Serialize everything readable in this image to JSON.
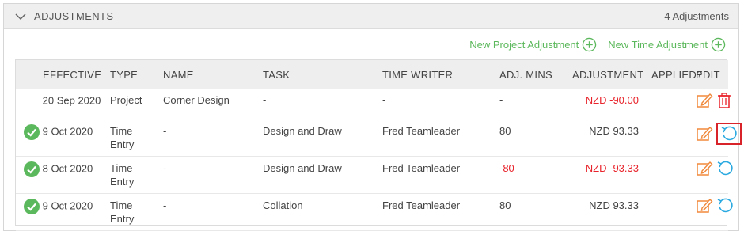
{
  "panel": {
    "title": "ADJUSTMENTS",
    "count_label": "4 Adjustments"
  },
  "actions": {
    "new_project_label": "New Project Adjustment",
    "new_time_label": "New Time Adjustment"
  },
  "table": {
    "headers": [
      "EFFECTIVE",
      "TYPE",
      "NAME",
      "TASK",
      "TIME WRITER",
      "ADJ. MINS",
      "ADJUSTMENT",
      "APPLIED?",
      "EDIT"
    ],
    "rows": [
      {
        "applied": false,
        "effective": "20 Sep 2020",
        "type": "Project",
        "type2": "",
        "name": "Corner Design",
        "task": "-",
        "writer": "-",
        "mins": "-",
        "adjustment": "NZD -90.00",
        "adjustment_negative": true,
        "mins_negative": false,
        "action": "delete"
      },
      {
        "applied": true,
        "effective": "9 Oct 2020",
        "type": "Time",
        "type2": "Entry",
        "name": "-",
        "task": "Design and Draw",
        "writer": "Fred Teamleader",
        "mins": "80",
        "adjustment": "NZD 93.33",
        "adjustment_negative": false,
        "mins_negative": false,
        "action": "undo-highlighted"
      },
      {
        "applied": true,
        "effective": "8 Oct 2020",
        "type": "Time",
        "type2": "Entry",
        "name": "-",
        "task": "Design and Draw",
        "writer": "Fred Teamleader",
        "mins": "-80",
        "adjustment": "NZD -93.33",
        "adjustment_negative": true,
        "mins_negative": true,
        "action": "undo"
      },
      {
        "applied": true,
        "effective": "9 Oct 2020",
        "type": "Time",
        "type2": "Entry",
        "name": "-",
        "task": "Collation",
        "writer": "Fred Teamleader",
        "mins": "80",
        "adjustment": "NZD 93.33",
        "adjustment_negative": false,
        "mins_negative": false,
        "action": "undo"
      }
    ]
  },
  "colors": {
    "green": "#5cb85c",
    "red": "#e8232b",
    "orange": "#f0883a",
    "blue": "#2aa9e0"
  }
}
